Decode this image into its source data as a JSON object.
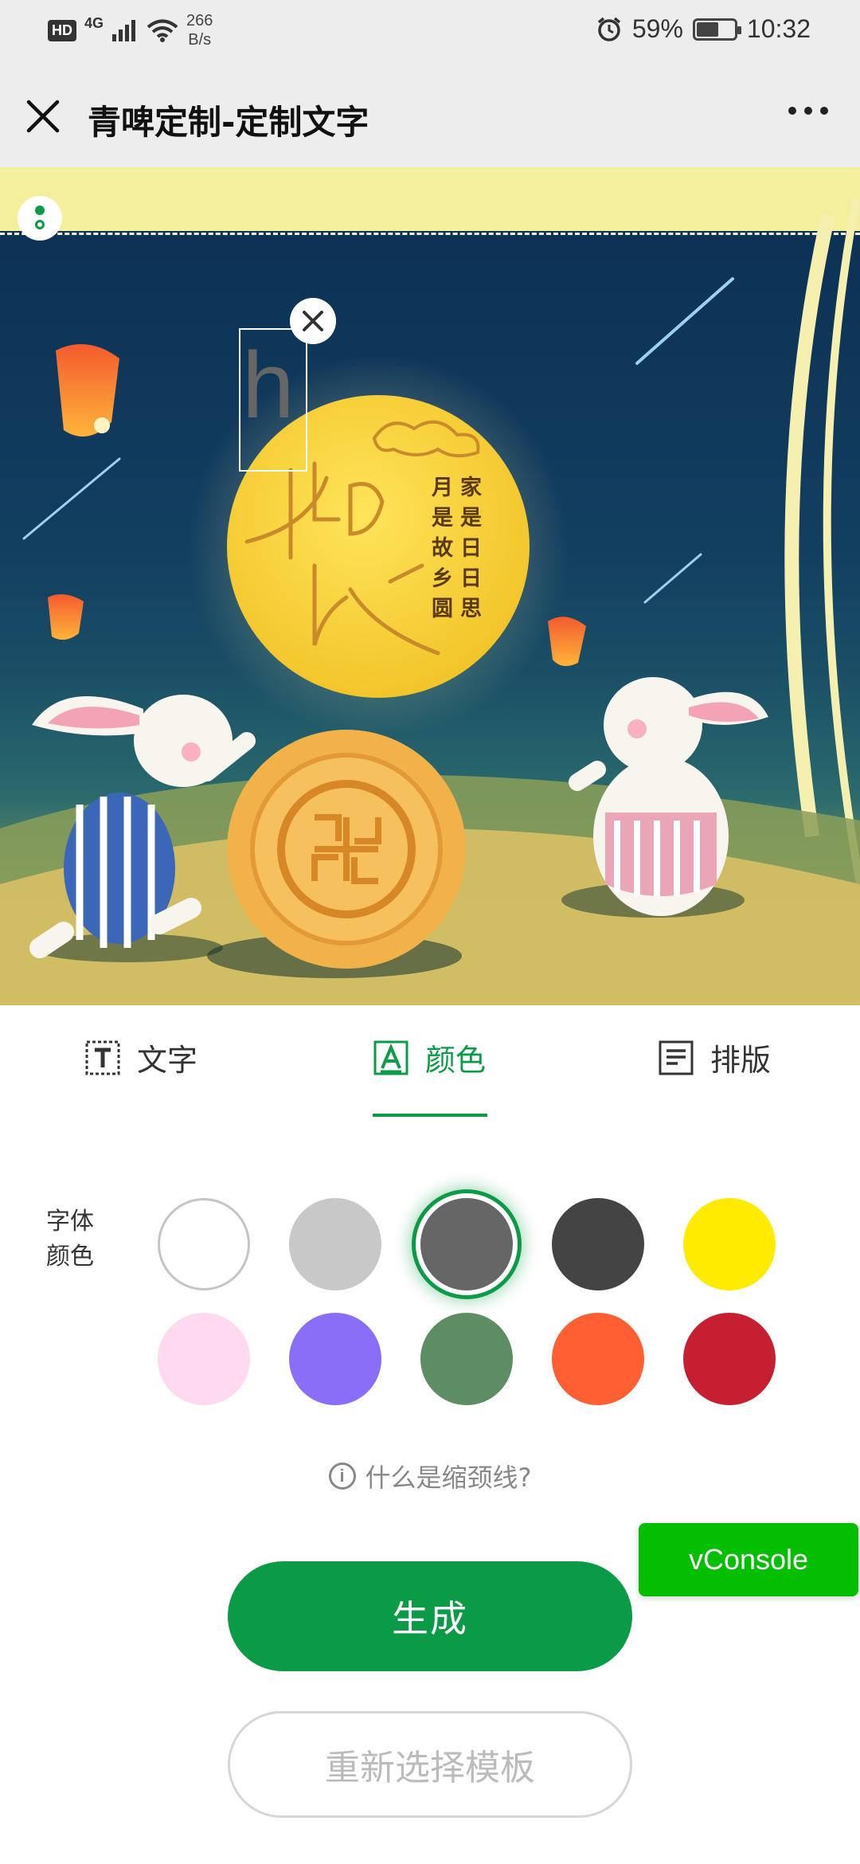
{
  "status_bar": {
    "hd_badge": "HD",
    "network": "4G",
    "speed_value": "266",
    "speed_unit": "B/s",
    "battery_text": "59%",
    "battery_level": 0.59,
    "time": "10:32"
  },
  "nav": {
    "title": "青啤定制-定制文字"
  },
  "canvas": {
    "selected_text": "h",
    "selected_text_color": "#666666",
    "poem_col1": [
      "家",
      "是",
      "日",
      "日",
      "思"
    ],
    "poem_col2": [
      "月",
      "是",
      "故",
      "乡",
      "圆"
    ]
  },
  "tabs": [
    {
      "label": "文字",
      "icon": "text-icon"
    },
    {
      "label": "颜色",
      "icon": "font-color-icon",
      "active": true
    },
    {
      "label": "排版",
      "icon": "layout-icon"
    }
  ],
  "color_panel": {
    "label": "字体颜色",
    "selected_index": 2,
    "colors": [
      "#ffffff",
      "#c8c8c8",
      "#666666",
      "#444444",
      "#ffeb00",
      "#ffd9ef",
      "#8b6ef7",
      "#5e8d63",
      "#ff5f33",
      "#c51f31"
    ]
  },
  "help_text": "什么是缩颈线?",
  "vconsole_label": "vConsole",
  "actions": {
    "generate": "生成",
    "reselect": "重新选择模板"
  }
}
